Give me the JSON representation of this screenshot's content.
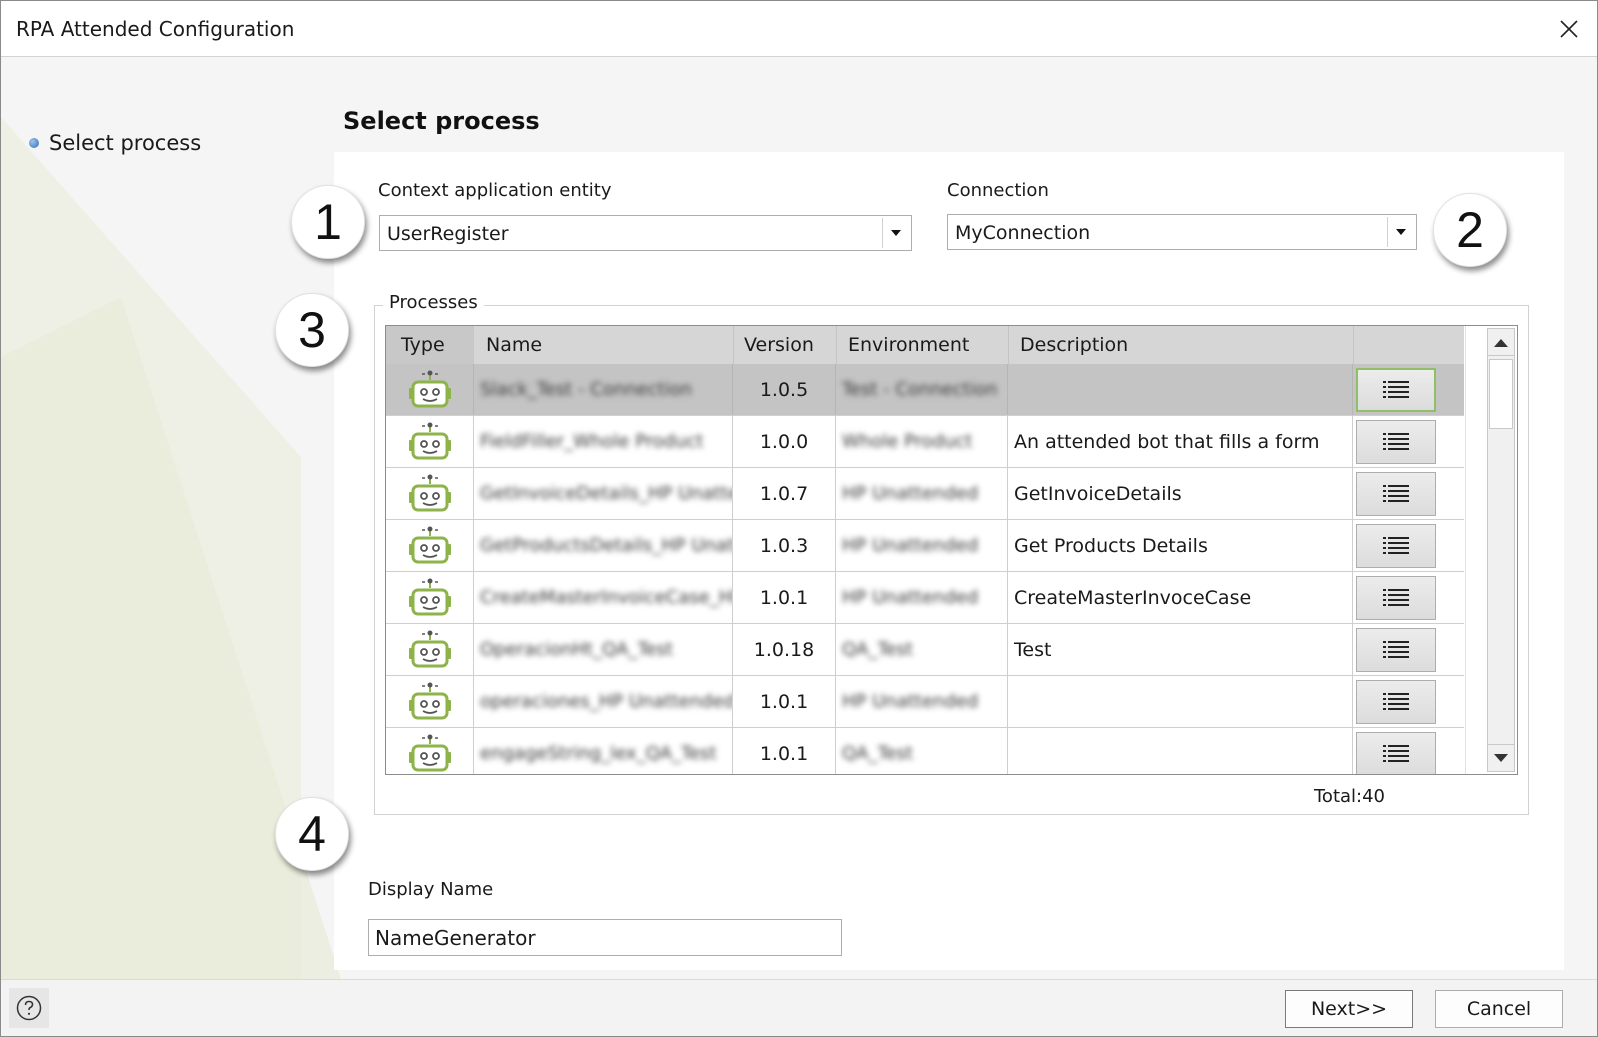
{
  "window": {
    "title": "RPA Attended Configuration"
  },
  "nav": {
    "steps": [
      {
        "label": "Select process"
      }
    ]
  },
  "page": {
    "title": "Select process"
  },
  "context_entity": {
    "label": "Context application entity",
    "value": "UserRegister"
  },
  "connection": {
    "label": "Connection",
    "value": "MyConnection"
  },
  "processes": {
    "label": "Processes",
    "columns": {
      "type": "Type",
      "name": "Name",
      "version": "Version",
      "environment": "Environment",
      "description": "Description"
    },
    "rows": [
      {
        "name": "Slack_Test - Connection",
        "version": "1.0.5",
        "environment": "Test - Connection",
        "description": "",
        "selected": true
      },
      {
        "name": "FieldFiller_Whole Product",
        "version": "1.0.0",
        "environment": "Whole Product",
        "description": "An attended bot that fills a form",
        "selected": false
      },
      {
        "name": "GetInvoiceDetails_HP Unattended",
        "version": "1.0.7",
        "environment": "HP Unattended",
        "description": "GetInvoiceDetails",
        "selected": false
      },
      {
        "name": "GetProductsDetails_HP Unattended",
        "version": "1.0.3",
        "environment": "HP Unattended",
        "description": "Get Products Details",
        "selected": false
      },
      {
        "name": "CreateMasterInvoiceCase_HP Unattended",
        "version": "1.0.1",
        "environment": "HP Unattended",
        "description": "CreateMasterInvoceCase",
        "selected": false
      },
      {
        "name": "OperacionHt_QA_Test",
        "version": "1.0.18",
        "environment": "QA_Test",
        "description": "Test",
        "selected": false
      },
      {
        "name": "operaciones_HP Unattended",
        "version": "1.0.1",
        "environment": "HP Unattended",
        "description": "",
        "selected": false
      },
      {
        "name": "engageString_lex_QA_Test",
        "version": "1.0.1",
        "environment": "QA_Test",
        "description": "",
        "selected": false
      }
    ],
    "total_label": "Total:40"
  },
  "display_name": {
    "label": "Display Name",
    "value": "NameGenerator"
  },
  "callouts": [
    "1",
    "2",
    "3",
    "4"
  ],
  "footer": {
    "next_label": "Next>>",
    "cancel_label": "Cancel"
  },
  "icons": {
    "close": "close-icon",
    "help": "help-icon",
    "bot": "robot-icon",
    "details": "list-icon",
    "scroll_up": "arrow-up-icon",
    "scroll_down": "arrow-down-icon",
    "dropdown": "chevron-down-icon"
  },
  "colors": {
    "bot_icon": "#8db34a",
    "selected_row": "#c4c4c4",
    "focus_border": "#8fbf66"
  }
}
